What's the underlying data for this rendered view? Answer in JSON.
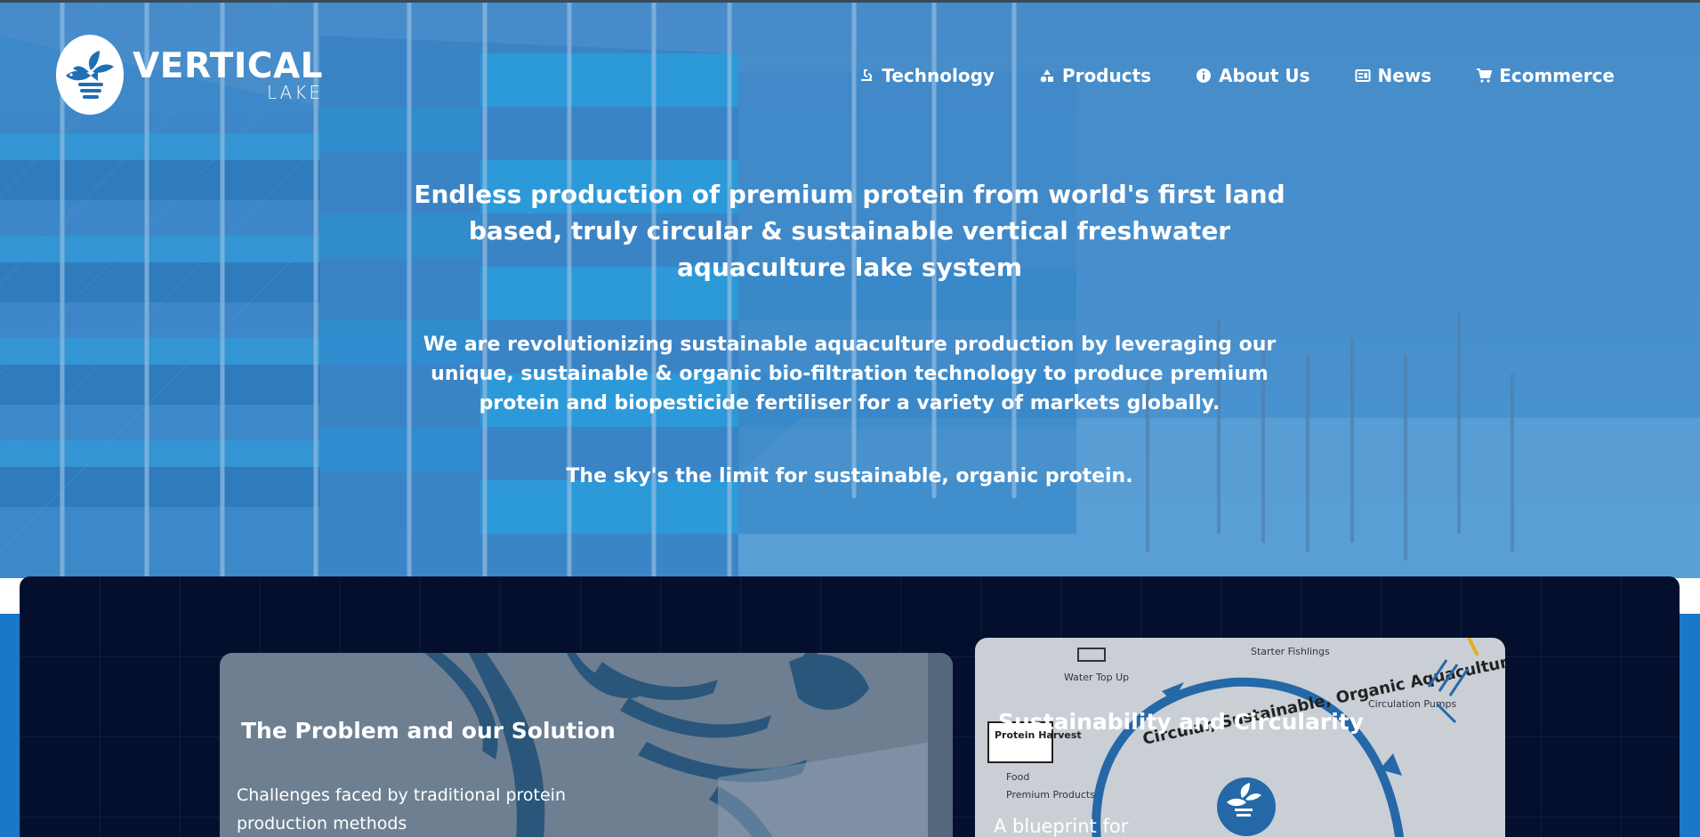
{
  "brand": {
    "word1": "VERTICAL",
    "word2": "LAKE"
  },
  "nav": {
    "items": [
      {
        "label": "Technology",
        "icon": "technology-icon"
      },
      {
        "label": "Products",
        "icon": "products-icon"
      },
      {
        "label": "About Us",
        "icon": "info-icon"
      },
      {
        "label": "News",
        "icon": "news-icon"
      },
      {
        "label": "Ecommerce",
        "icon": "cart-icon"
      }
    ]
  },
  "hero": {
    "headline": "Endless production of premium protein from world's first land based, truly circular & sustainable vertical freshwater aquaculture lake system",
    "subtext": "We are revolutionizing sustainable aquaculture production by leveraging our unique, sustainable & organic bio-filtration technology to produce premium protein and biopesticide fertiliser for a variety of markets globally.",
    "tagline": "The sky's the limit for sustainable, organic protein."
  },
  "cards": [
    {
      "title": "The Problem and our Solution",
      "text": "Challenges faced by traditional protein production methods"
    },
    {
      "title": "Sustainability and Circularity",
      "text": "A blueprint for",
      "diagram_labels": {
        "starter": "Starter Fishlings",
        "water": "Water Top Up",
        "pumps": "Circulation Pumps",
        "harvest": "Protein Harvest",
        "food": "Food",
        "premium": "Premium Products",
        "ring": "Circular, Sustainable, Organic Aquaculture"
      }
    }
  ],
  "colors": {
    "hero_blue": "#4a93cf",
    "panel_navy": "#040f2e",
    "band_blue": "#1a78c8",
    "text": "#ffffff"
  }
}
